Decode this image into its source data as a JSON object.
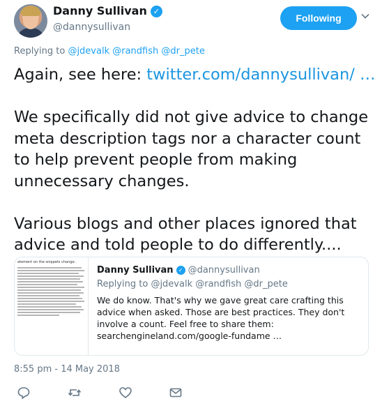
{
  "author": {
    "display_name": "Danny Sullivan",
    "handle": "@dannysullivan",
    "verified": true
  },
  "follow_button": {
    "label": "Following"
  },
  "reply_context": {
    "prefix": "Replying to",
    "mentions": [
      "@jdevalk",
      "@randfish",
      "@dr_pete"
    ]
  },
  "tweet": {
    "line1_text": "Again, see here: ",
    "line1_link": "twitter.com/dannysullivan/ …",
    "para2": "We specifically did not give advice to change meta description tags nor a character count to help prevent people from making unnecessary changes.",
    "para3": "Various blogs and other places ignored that advice and told people to do differently...."
  },
  "quoted_tweet": {
    "display_name": "Danny Sullivan",
    "handle": "@dannysullivan",
    "replying_prefix": "Replying to",
    "replying_mentions": "@jdevalk @randfish @dr_pete",
    "text": "We do know. That's why we gave great care crafting this advice when asked. Those are best practices. They don't involve a count. Feel free to share them: searchengineland.com/google-fundame …",
    "thumbnail_title": "atement on the snippets change:"
  },
  "timestamp": "8:55 pm - 14 May 2018",
  "colors": {
    "accent": "#1da1f2",
    "secondary_text": "#657786",
    "border": "#e1e8ed"
  },
  "icons": [
    "chevron-down-icon",
    "verified-icon",
    "reply-icon",
    "retweet-icon",
    "like-icon",
    "message-icon"
  ]
}
